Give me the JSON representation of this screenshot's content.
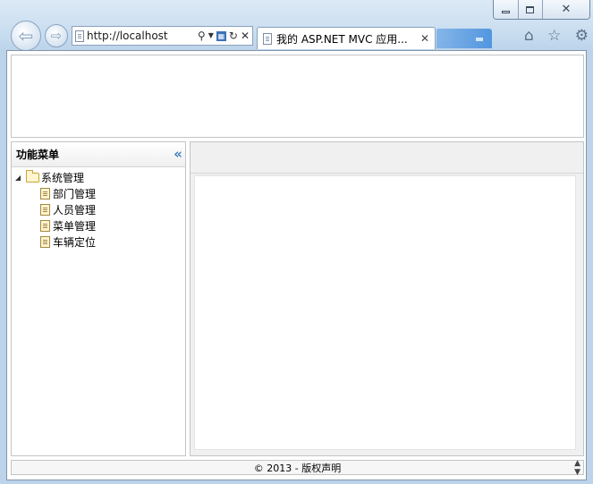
{
  "browser": {
    "address": "http://localhost",
    "tab_title": "我的 ASP.NET MVC 应用...",
    "icons": {
      "back": "back-arrow-icon",
      "forward": "forward-arrow-icon",
      "search": "search-icon",
      "refresh": "refresh-icon",
      "stop": "close-icon",
      "home": "home-icon",
      "favorites": "star-icon",
      "tools": "gear-icon"
    }
  },
  "sidebar": {
    "title": "功能菜单",
    "tree": {
      "root_label": "系统管理",
      "children": [
        {
          "label": "部门管理"
        },
        {
          "label": "人员管理"
        },
        {
          "label": "菜单管理"
        },
        {
          "label": "车辆定位"
        }
      ]
    }
  },
  "footer": {
    "text": "© 2013 - 版权声明"
  },
  "colors": {
    "accent": "#3c7fc4",
    "chrome": "#c7dcef",
    "border": "#c4c4c4"
  }
}
